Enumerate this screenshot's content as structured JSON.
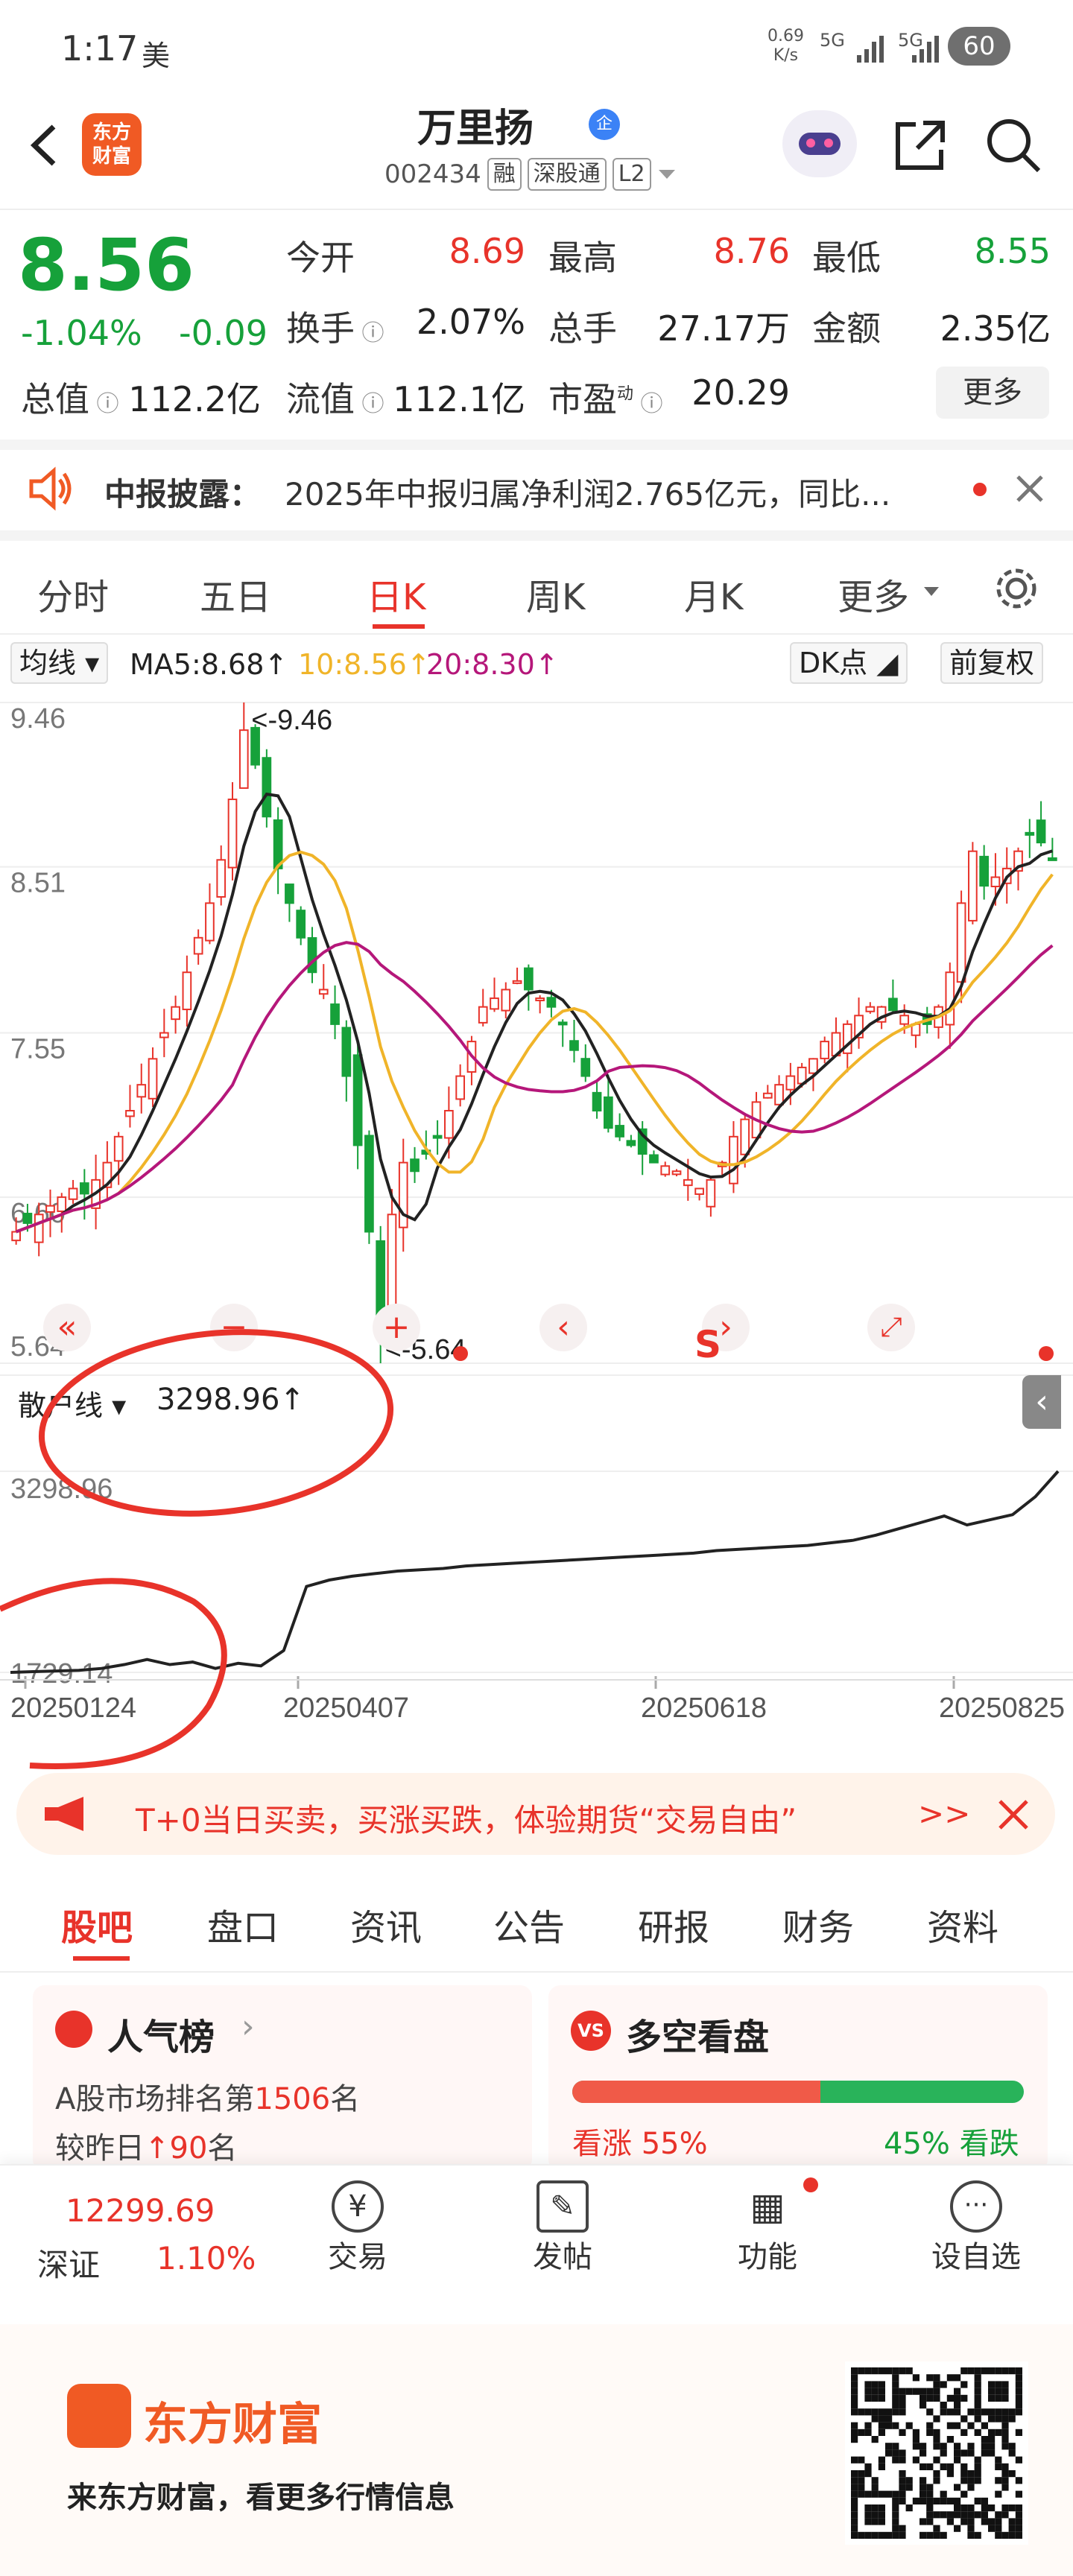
{
  "status": {
    "time": "1:17",
    "sub": "美",
    "speed": "0.69",
    "speed_unit": "K/s",
    "net1": "5G",
    "net2": "5G",
    "battery": "60"
  },
  "header": {
    "logo_line1": "东方",
    "logo_line2": "财富",
    "name": "万里扬",
    "badge": "企",
    "code": "002434",
    "tags": [
      "融",
      "深股通",
      "L2"
    ]
  },
  "quote": {
    "price": "8.56",
    "pct": "-1.04%",
    "chg": "-0.09",
    "rows": [
      [
        {
          "l": "今开",
          "v": "8.69",
          "c": "red"
        },
        {
          "l": "最高",
          "v": "8.76",
          "c": "red"
        },
        {
          "l": "最低",
          "v": "8.55",
          "c": "green"
        }
      ],
      [
        {
          "l": "换手",
          "v": "2.07%",
          "c": "dark"
        },
        {
          "l": "总手",
          "v": "27.17万",
          "c": "dark"
        },
        {
          "l": "金额",
          "v": "2.35亿",
          "c": "dark"
        }
      ],
      [
        {
          "l": "总值",
          "v": "112.2亿",
          "c": "dark"
        },
        {
          "l": "流值",
          "v": "112.1亿",
          "c": "dark"
        },
        {
          "l": "市盈",
          "v": "20.29",
          "c": "dark"
        }
      ]
    ],
    "more": "更多",
    "pe_sup": "动"
  },
  "notice": {
    "label": "中报披露：",
    "text": "2025年中报归属净利润2.765亿元，同比..."
  },
  "tabs": [
    "分时",
    "五日",
    "日K",
    "周K",
    "月K",
    "更多"
  ],
  "ma_bar": {
    "mode": "均线",
    "ma5": "MA5:8.68↑",
    "ma10": "10:8.56↑",
    "ma20": "20:8.30↑",
    "dk": "DK点",
    "fq": "前复权"
  },
  "colors": {
    "up": "#e8332a",
    "down": "#16a13a",
    "ma5": "#222222",
    "ma10": "#f0b429",
    "ma20": "#b5177a"
  },
  "chart_data": [
    {
      "type": "candlestick",
      "yticks": [
        "9.46",
        "8.51",
        "7.55",
        "6.60",
        "5.64"
      ],
      "ylim": [
        5.64,
        9.46
      ],
      "annotations": [
        "<-9.46",
        "<-5.64"
      ],
      "close": [
        6.4,
        6.45,
        6.5,
        6.55,
        6.6,
        6.65,
        6.62,
        6.7,
        6.8,
        6.95,
        7.1,
        7.25,
        7.4,
        7.55,
        7.7,
        7.9,
        8.1,
        8.3,
        8.55,
        8.9,
        9.3,
        9.1,
        8.8,
        8.5,
        8.3,
        8.1,
        7.9,
        7.8,
        7.6,
        7.3,
        6.9,
        6.4,
        5.9,
        6.5,
        6.8,
        6.75,
        6.85,
        6.95,
        7.1,
        7.3,
        7.5,
        7.7,
        7.75,
        7.8,
        7.85,
        7.8,
        7.75,
        7.7,
        7.6,
        7.45,
        7.3,
        7.1,
        7.0,
        6.95,
        6.9,
        6.85,
        6.8,
        6.78,
        6.75,
        6.7,
        6.65,
        6.7,
        6.8,
        6.95,
        7.05,
        7.15,
        7.2,
        7.25,
        7.3,
        7.35,
        7.4,
        7.5,
        7.55,
        7.6,
        7.65,
        7.7,
        7.7,
        7.68,
        7.65,
        7.6,
        7.6,
        7.7,
        7.9,
        8.3,
        8.6,
        8.4,
        8.45,
        8.5,
        8.6,
        8.7,
        8.65,
        8.56
      ],
      "ma5_current": 8.68,
      "ma10_current": 8.56,
      "ma20_current": 8.3
    },
    {
      "type": "line",
      "name": "散户线",
      "current": "3298.96↑",
      "yticks": [
        "3298.96",
        "1729.14"
      ],
      "ylim": [
        1729.14,
        3298.96
      ],
      "values": [
        1729,
        1735,
        1740,
        1745,
        1760,
        1790,
        1830,
        1790,
        1810,
        1760,
        1800,
        1780,
        1900,
        2400,
        2450,
        2480,
        2500,
        2520,
        2530,
        2540,
        2560,
        2570,
        2580,
        2590,
        2600,
        2610,
        2620,
        2630,
        2640,
        2650,
        2660,
        2680,
        2690,
        2700,
        2710,
        2720,
        2740,
        2760,
        2800,
        2850,
        2900,
        2950,
        2880,
        2920,
        2960,
        3100,
        3298.96
      ],
      "xticks": [
        "20250124",
        "20250407",
        "20250618",
        "20250825"
      ]
    }
  ],
  "chart_controls": {
    "s_label": "S"
  },
  "banner": {
    "text": "T+0当日买卖，买涨买跌，体验期货“交易自由”"
  },
  "sub_tabs": [
    "股吧",
    "盘口",
    "资讯",
    "公告",
    "研报",
    "财务",
    "资料"
  ],
  "cards": {
    "hot_title": "人气榜",
    "hot_line1": "A股市场排名第",
    "hot_rank": "1506",
    "hot_rank_suffix": "名",
    "hot_line2": "较昨日",
    "hot_up": "90",
    "hot_suffix2": "名",
    "vs_title": "多空看盘",
    "bull_label": "看涨",
    "bull_pct": "55%",
    "bear_pct": "45%",
    "bear_label": "看跌",
    "bull": 55
  },
  "bottom_bar": {
    "index_value": "12299.69",
    "index_name": "深证",
    "index_pct": "1.10%",
    "items": [
      "交易",
      "发帖",
      "功能",
      "设自选"
    ]
  },
  "footer": {
    "brand": "东方财富",
    "slogan": "来东方财富，看更多行情信息"
  }
}
